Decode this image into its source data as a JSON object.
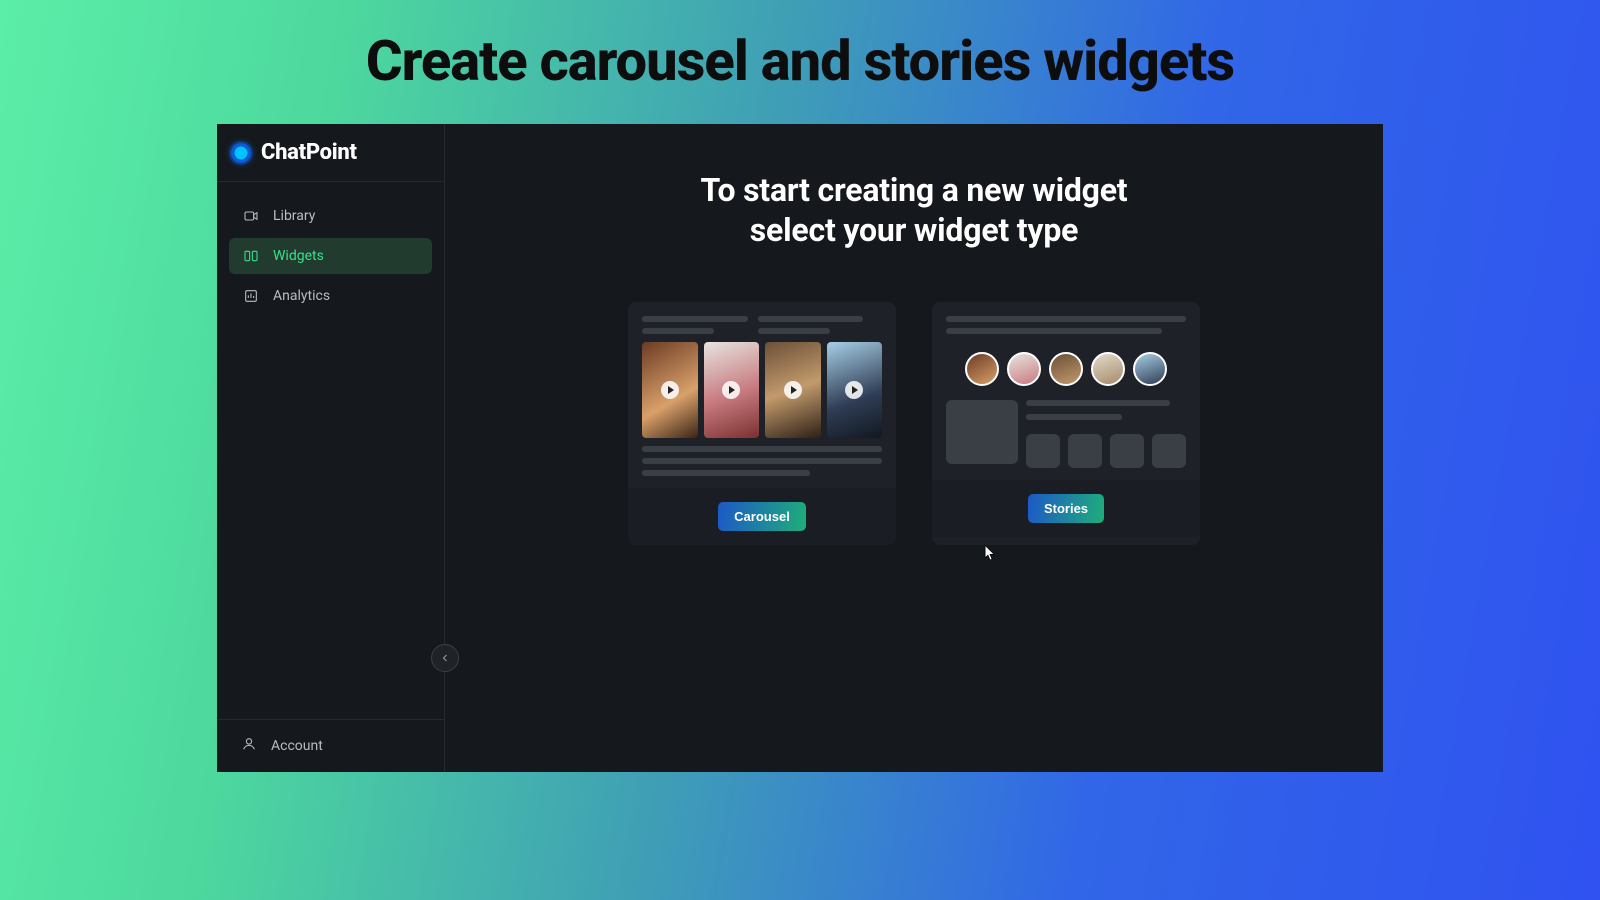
{
  "page": {
    "title": "Create carousel and stories widgets"
  },
  "brand": {
    "name": "ChatPoint"
  },
  "sidebar": {
    "items": [
      {
        "label": "Library"
      },
      {
        "label": "Widgets"
      },
      {
        "label": "Analytics"
      }
    ],
    "account_label": "Account"
  },
  "main": {
    "heading_line1": "To start creating a new widget",
    "heading_line2": "select your widget type"
  },
  "cards": {
    "carousel": {
      "button_label": "Carousel"
    },
    "stories": {
      "button_label": "Stories"
    }
  }
}
